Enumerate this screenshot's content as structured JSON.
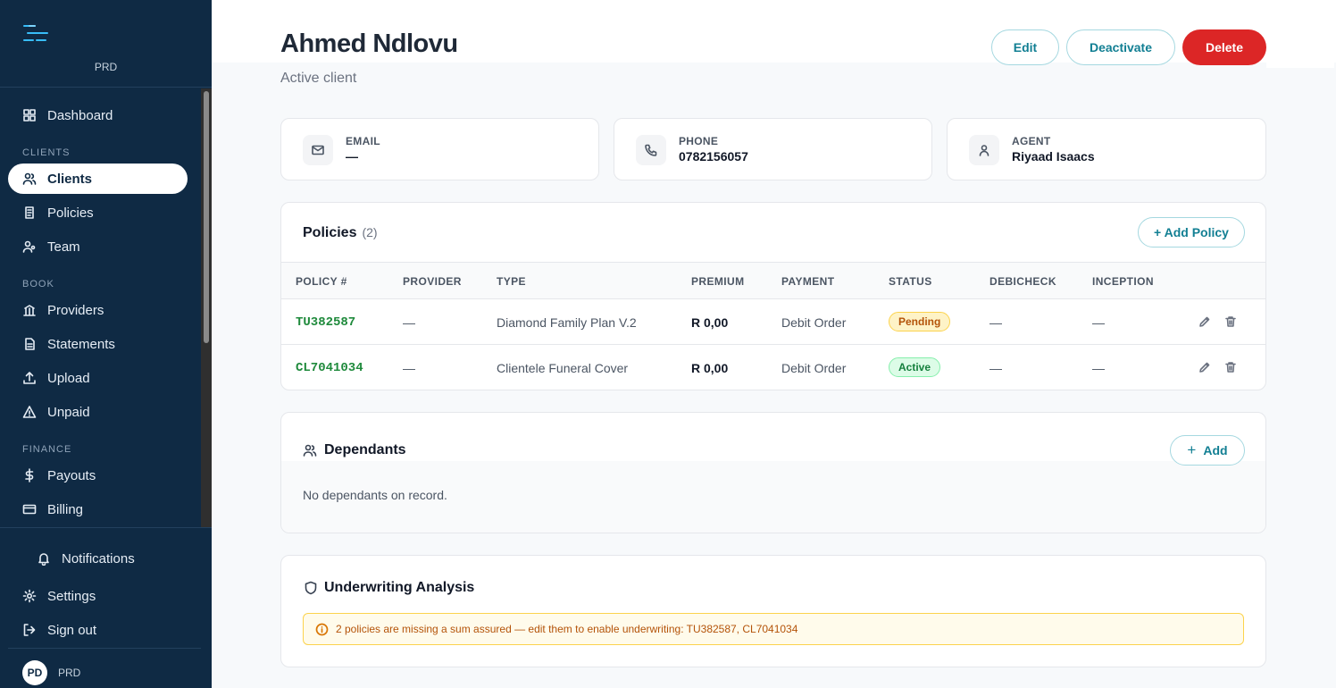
{
  "brand": {
    "name": "PRD"
  },
  "nav": {
    "dashboard": "Dashboard",
    "section_clients": "CLIENTS",
    "clients": "Clients",
    "policies": "Policies",
    "team": "Team",
    "section_book": "BOOK",
    "providers": "Providers",
    "statements": "Statements",
    "upload": "Upload",
    "unpaid": "Unpaid",
    "section_finance": "FINANCE",
    "payouts": "Payouts",
    "billing": "Billing",
    "notifications": "Notifications",
    "settings": "Settings",
    "sign_out": "Sign out"
  },
  "user": {
    "initials": "PD",
    "name": "PRD"
  },
  "client": {
    "name": "Ahmed Ndlovu",
    "status": "Active client",
    "actions": {
      "edit": "Edit",
      "deactivate": "Deactivate",
      "delete": "Delete"
    }
  },
  "info": {
    "email": {
      "label": "EMAIL",
      "value": "—"
    },
    "phone": {
      "label": "PHONE",
      "value": "0782156057"
    },
    "agent": {
      "label": "AGENT",
      "value": "Riyaad Isaacs"
    }
  },
  "policies": {
    "title": "Policies",
    "count": "(2)",
    "add_label": "+ Add Policy",
    "columns": [
      "POLICY #",
      "PROVIDER",
      "TYPE",
      "PREMIUM",
      "PAYMENT",
      "STATUS",
      "DEBICHECK",
      "INCEPTION"
    ],
    "rows": [
      {
        "policy": "TU382587",
        "provider": "—",
        "type": "Diamond Family Plan V.2",
        "premium": "R 0,00",
        "payment": "Debit Order",
        "status": "Pending",
        "debicheck": "—",
        "inception": "—"
      },
      {
        "policy": "CL7041034",
        "provider": "—",
        "type": "Clientele Funeral Cover",
        "premium": "R 0,00",
        "payment": "Debit Order",
        "status": "Active",
        "debicheck": "—",
        "inception": "—"
      }
    ]
  },
  "dependants": {
    "title": "Dependants",
    "add_label": "Add",
    "empty": "No dependants on record."
  },
  "underwriting": {
    "title": "Underwriting Analysis",
    "notice": "2 policies are missing a sum assured — edit them to enable underwriting: TU382587, CL7041034"
  },
  "colors": {
    "sidebar": "#0f2a44",
    "accent": "#127f93",
    "danger": "#dc2626",
    "policy_code": "#1f8a3c"
  }
}
